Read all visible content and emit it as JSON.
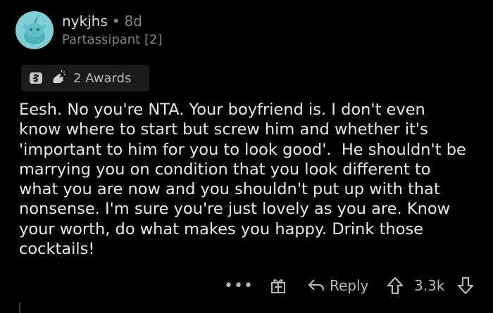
{
  "comment": {
    "username": "nykjhs",
    "separator": "•",
    "age": "8d",
    "flair": "Partassipant [2]",
    "awards_label": "2 Awards",
    "body": "Eesh. No you're NTA. Your boyfriend is. I don't even\nknow where to start but screw him and whether it's\n'important to him for you to look good'.  He shouldn't be\nmarrying you on condition that you look different to\nwhat you are now and you shouldn't put up with that\nnonsense. I'm sure you're just lovely as you are. Know\nyour worth, do what makes you happy. Drink those\ncocktails!",
    "more_label": "•••",
    "reply_label": "Reply",
    "score": "3.3k"
  },
  "icons": {
    "avatar": "snoo-avatar-icon",
    "award_1": "silver-award-icon",
    "award_2": "wholesome-award-icon",
    "gift": "gift-icon",
    "reply": "reply-arrow-icon",
    "upvote": "upvote-arrow-icon",
    "downvote": "downvote-arrow-icon"
  },
  "colors": {
    "background": "#000000",
    "avatar_bg": "#7ecfd6",
    "text_primary": "#e6e8ea",
    "text_muted": "#818384",
    "award_bg": "#1a1a1b"
  }
}
